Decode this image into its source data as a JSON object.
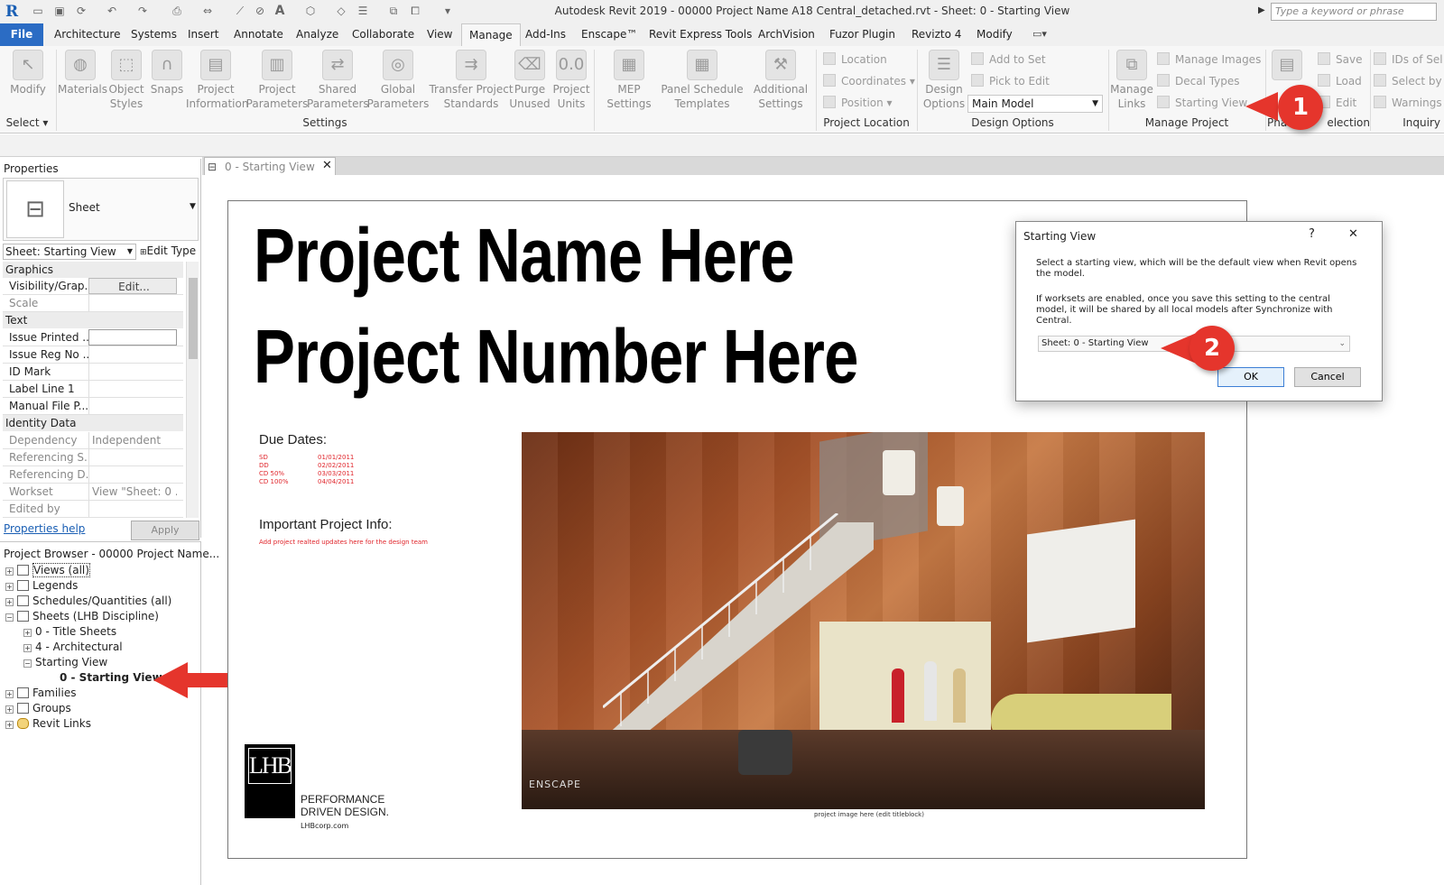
{
  "app": {
    "title": "Autodesk Revit 2019 - 00000 Project Name A18 Central_detached.rvt - Sheet: 0 - Starting View",
    "search_placeholder": "Type a keyword or phrase"
  },
  "tabs": [
    "File",
    "Architecture",
    "Systems",
    "Insert",
    "Annotate",
    "Analyze",
    "Collaborate",
    "View",
    "Manage",
    "Add-Ins",
    "Enscape™",
    "Revit Express Tools",
    "ArchVision",
    "Fuzor Plugin",
    "Revizto 4",
    "Modify"
  ],
  "active_tab": "Manage",
  "ribbon": {
    "modify": "Modify",
    "select": "Select ▾",
    "materials": "Materials",
    "object_styles": "Object Styles",
    "snaps": "Snaps",
    "project_information": "Project Information",
    "project_parameters": "Project Parameters",
    "shared_parameters": "Shared Parameters",
    "global_parameters": "Global Parameters",
    "transfer_project_standards": "Transfer Project Standards",
    "purge_unused": "Purge Unused",
    "project_units": "Project Units",
    "settings_panel": "Settings",
    "mep_settings": "MEP Settings",
    "panel_schedule_templates": "Panel Schedule Templates",
    "additional_settings": "Additional Settings",
    "location": "Location",
    "coordinates": "Coordinates",
    "position": "Position",
    "project_location_panel": "Project Location",
    "design_options": "Design Options",
    "add_to_set": "Add to Set",
    "pick_to_edit": "Pick to Edit",
    "main_model": "Main Model",
    "design_options_panel": "Design Options",
    "manage_links": "Manage Links",
    "manage_images": "Manage  Images",
    "decal_types": "Decal  Types",
    "starting_view": "Starting  View",
    "manage_project_panel": "Manage Project",
    "phases_partial": "Pha",
    "save": "Save",
    "load": "Load",
    "edit": "Edit",
    "selection_partial": "election",
    "ids_of": "IDs of  Sel",
    "select_by": "Select  by",
    "warnings": "Warnings",
    "inquiry_panel": "Inquiry"
  },
  "markers": {
    "one": "1",
    "two": "2"
  },
  "properties": {
    "header": "Properties",
    "type_name": "Sheet",
    "selector": "Sheet: Starting View",
    "edit_type": "Edit Type",
    "groups": {
      "graphics": "Graphics",
      "text": "Text",
      "identity": "Identity Data"
    },
    "rows": [
      {
        "key": "Visibility/Grap...",
        "value": "Edit..."
      },
      {
        "key": "Scale",
        "value": ""
      },
      {
        "key": "Issue Printed ...",
        "value": ""
      },
      {
        "key": "Issue Reg No ...",
        "value": ""
      },
      {
        "key": "ID Mark",
        "value": ""
      },
      {
        "key": "Label Line 1",
        "value": ""
      },
      {
        "key": "Manual File P...",
        "value": ""
      },
      {
        "key": "Dependency",
        "value": "Independent"
      },
      {
        "key": "Referencing S...",
        "value": ""
      },
      {
        "key": "Referencing D...",
        "value": ""
      },
      {
        "key": "Workset",
        "value": "View \"Sheet: 0 ..."
      },
      {
        "key": "Edited by",
        "value": ""
      }
    ],
    "help": "Properties help",
    "apply": "Apply"
  },
  "browser": {
    "title": "Project Browser - 00000 Project Name...",
    "items": [
      "Views (all)",
      "Legends",
      "Schedules/Quantities (all)",
      "Sheets (LHB Discipline)",
      "0 - Title Sheets",
      "4 - Architectural",
      "Starting View",
      "0 - Starting View",
      "Families",
      "Groups",
      "Revit Links"
    ]
  },
  "view_tab": "0 - Starting View",
  "sheet": {
    "title": "Project Name Here",
    "number": "Project Number Here",
    "due_dates_heading": "Due Dates:",
    "due_dates": [
      {
        "phase": "SD",
        "date": "01/01/2011"
      },
      {
        "phase": "DD",
        "date": "02/02/2011"
      },
      {
        "phase": "CD 50%",
        "date": "03/03/2011"
      },
      {
        "phase": "CD 100%",
        "date": "04/04/2011"
      }
    ],
    "info_heading": "Important Project Info:",
    "info_note": "Add project realted updates here for the design team",
    "image_caption": "project image here (edit titleblock)",
    "render_watermark": "ENSCAPE",
    "logo_text": "LHB",
    "tagline_1": "PERFORMANCE",
    "tagline_2": "DRIVEN DESIGN.",
    "website": "LHBcorp.com"
  },
  "dialog": {
    "title": "Starting View",
    "help": "?",
    "close": "✕",
    "text1": "Select a starting view, which will be the default view when Revit opens the model.",
    "text2": "If worksets are enabled, once you save this setting to the central model, it will be shared by all local models after Synchronize with Central.",
    "selected": "Sheet: 0 - Starting View",
    "ok": "OK",
    "cancel": "Cancel"
  },
  "colors": {
    "file_tab": "#2b6cc4",
    "marker": "#e5352c",
    "due_text": "#e0252b"
  }
}
